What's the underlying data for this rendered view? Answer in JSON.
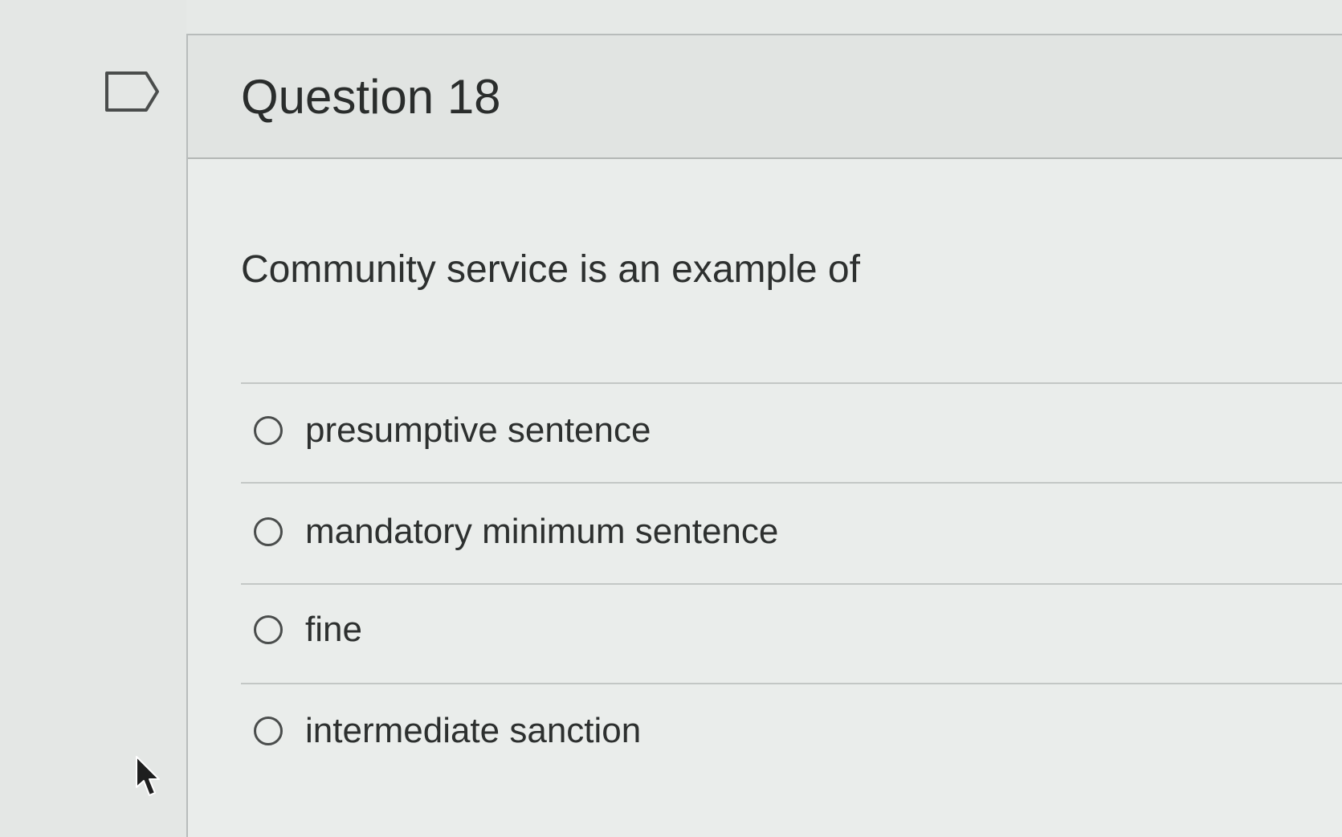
{
  "question": {
    "title": "Question 18",
    "prompt": "Community service is an example of",
    "answers": [
      {
        "label": "presumptive sentence"
      },
      {
        "label": "mandatory minimum sentence"
      },
      {
        "label": "fine"
      },
      {
        "label": "intermediate sanction"
      }
    ]
  },
  "icons": {
    "flag": "flag-bookmark-icon",
    "cursor": "mouse-pointer-icon"
  },
  "colors": {
    "text": "#2d302f",
    "border": "#b8bcbb"
  }
}
